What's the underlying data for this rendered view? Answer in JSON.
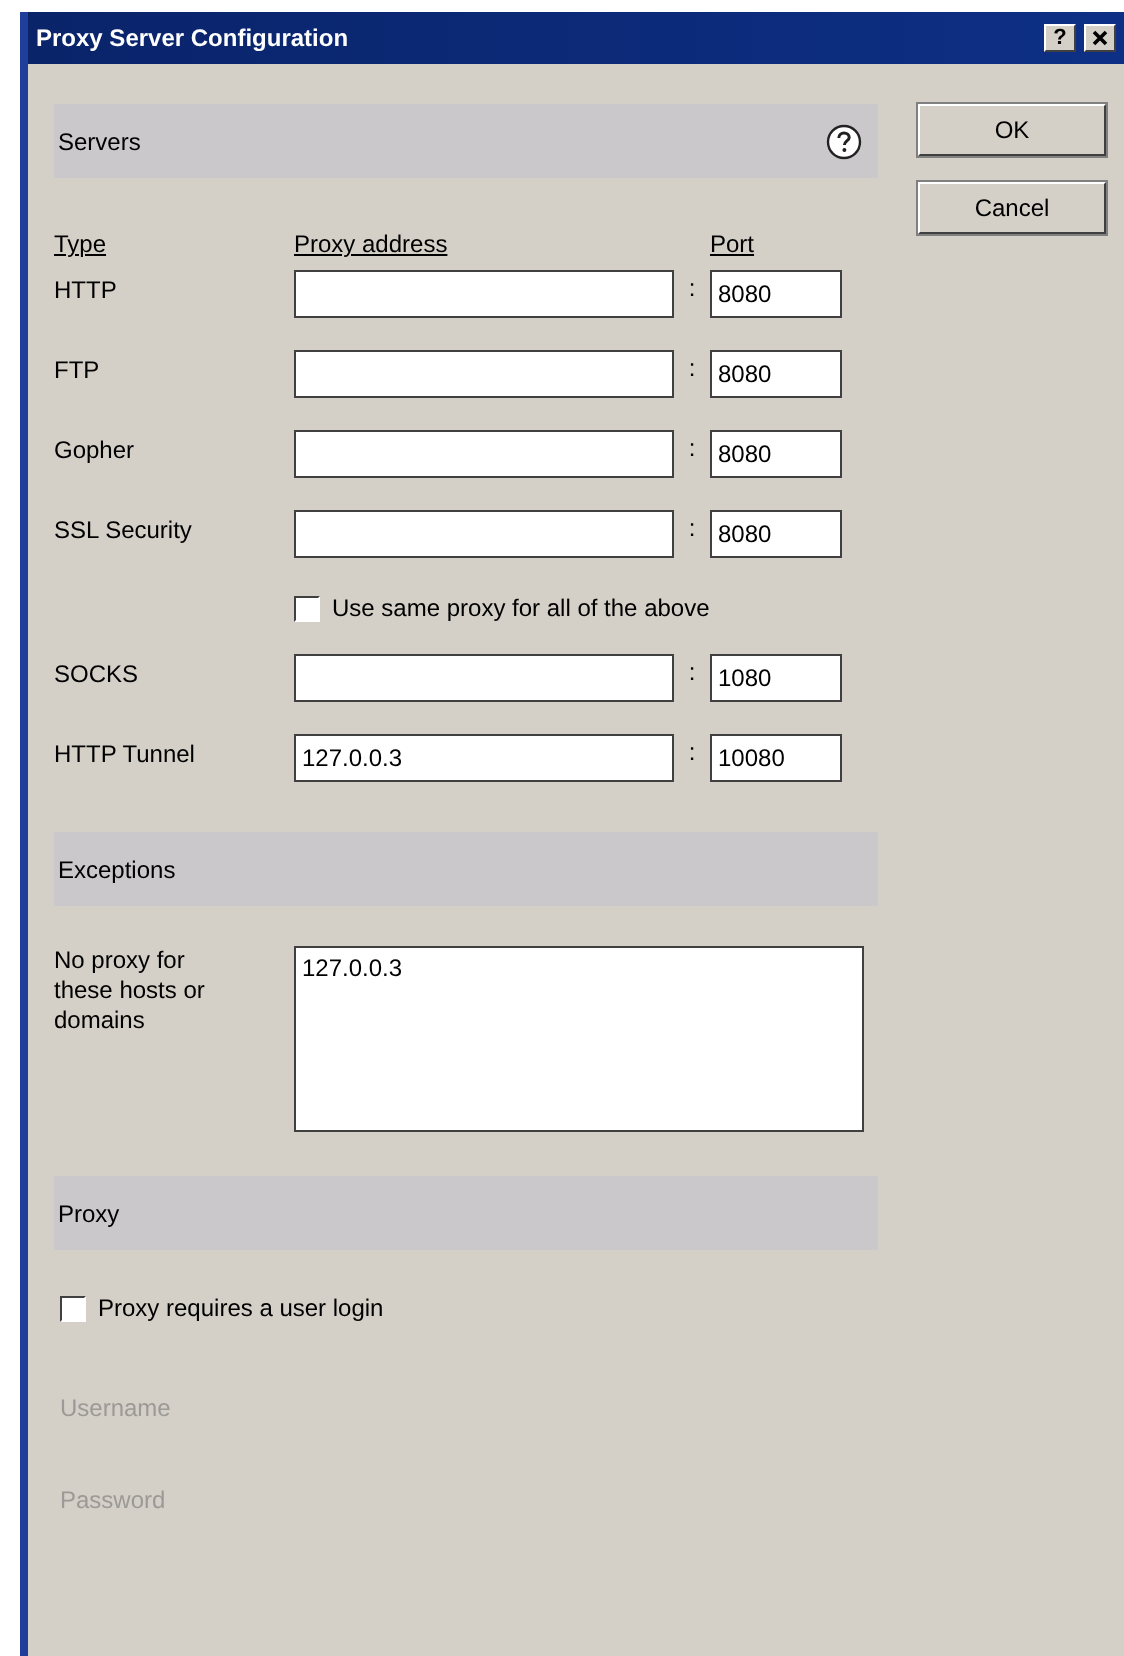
{
  "window": {
    "title": "Proxy Server Configuration",
    "help_button": "?"
  },
  "buttons": [
    "OK",
    "Cancel"
  ],
  "servers": {
    "header": "Servers",
    "columns": [
      "Type",
      "Proxy address",
      "Port"
    ],
    "rows": [
      {
        "kind": "server",
        "type": "HTTP",
        "port": "8080"
      },
      {
        "kind": "server",
        "type": "FTP",
        "port": "8080"
      },
      {
        "kind": "server",
        "type": "Gopher",
        "port": "8080"
      },
      {
        "kind": "server",
        "type": "SSL Security",
        "port": "8080"
      },
      {
        "kind": "checkbox",
        "label": "Use same proxy for all of the above",
        "checked": false
      },
      {
        "kind": "server",
        "type": "SOCKS",
        "port": "1080"
      },
      {
        "kind": "server",
        "type": "HTTP Tunnel",
        "address": "127.0.0.3",
        "port": "10080"
      }
    ],
    "separator": ":"
  },
  "exceptions": {
    "header": "Exceptions",
    "label": "No proxy for these hosts or domains",
    "value": "127.0.0.3"
  },
  "proxy": {
    "header": "Proxy",
    "login": {
      "label": "Proxy requires a user login",
      "checked": false
    },
    "fields": [
      {
        "label": "Username",
        "disabled": true
      },
      {
        "label": "Password",
        "disabled": true
      }
    ]
  }
}
